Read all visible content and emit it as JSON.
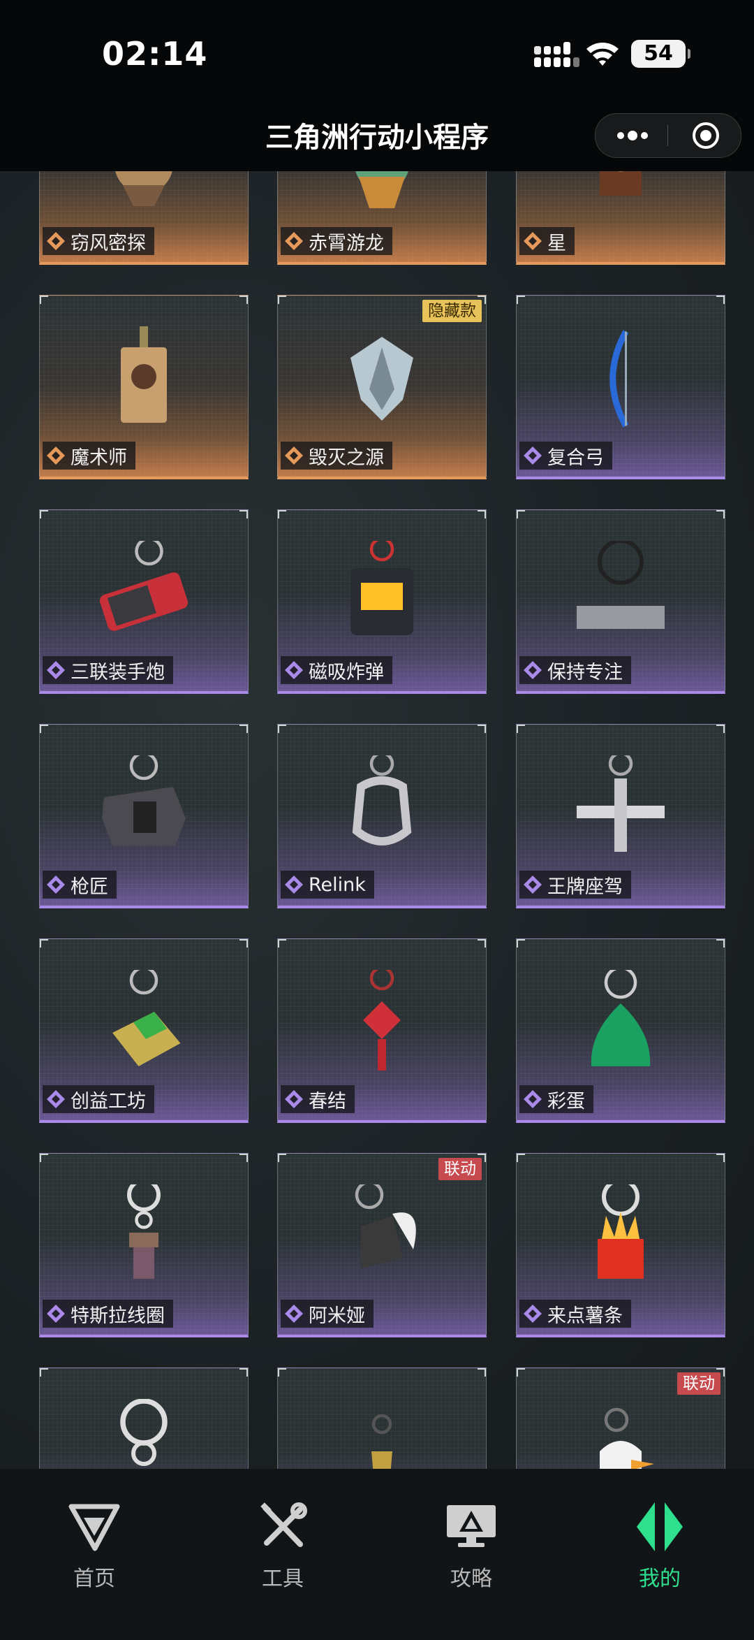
{
  "status_bar": {
    "time": "02:14",
    "battery": "54"
  },
  "nav": {
    "title": "三角洲行动小程序"
  },
  "items": [
    {
      "name": "窃风密探",
      "rarity": "gold",
      "badge": ""
    },
    {
      "name": "赤霄游龙",
      "rarity": "gold",
      "badge": ""
    },
    {
      "name": "星",
      "rarity": "gold",
      "badge": ""
    },
    {
      "name": "魔术师",
      "rarity": "gold",
      "badge": ""
    },
    {
      "name": "毁灭之源",
      "rarity": "gold",
      "badge": "隐藏款"
    },
    {
      "name": "复合弓",
      "rarity": "purple",
      "badge": ""
    },
    {
      "name": "三联装手炮",
      "rarity": "purple",
      "badge": ""
    },
    {
      "name": "磁吸炸弹",
      "rarity": "purple",
      "badge": ""
    },
    {
      "name": "保持专注",
      "rarity": "purple",
      "badge": ""
    },
    {
      "name": "枪匠",
      "rarity": "purple",
      "badge": ""
    },
    {
      "name": "Relink",
      "rarity": "purple",
      "badge": ""
    },
    {
      "name": "王牌座驾",
      "rarity": "purple",
      "badge": ""
    },
    {
      "name": "创益工坊",
      "rarity": "purple",
      "badge": ""
    },
    {
      "name": "春结",
      "rarity": "purple",
      "badge": ""
    },
    {
      "name": "彩蛋",
      "rarity": "purple",
      "badge": ""
    },
    {
      "name": "特斯拉线圈",
      "rarity": "purple",
      "badge": ""
    },
    {
      "name": "阿米娅",
      "rarity": "purple",
      "badge": "联动"
    },
    {
      "name": "来点薯条",
      "rarity": "purple",
      "badge": ""
    },
    {
      "name": "",
      "rarity": "purple",
      "badge": ""
    },
    {
      "name": "",
      "rarity": "purple",
      "badge": ""
    },
    {
      "name": "",
      "rarity": "purple",
      "badge": "联动"
    }
  ],
  "colors": {
    "gold": "#e59a5c",
    "purple": "#a98ae8",
    "active_tab": "#2ee08e"
  },
  "tabs": [
    {
      "label": "首页",
      "icon": "home-icon",
      "active": false
    },
    {
      "label": "工具",
      "icon": "tools-icon",
      "active": false
    },
    {
      "label": "攻略",
      "icon": "guide-icon",
      "active": false
    },
    {
      "label": "我的",
      "icon": "profile-icon",
      "active": true
    }
  ]
}
